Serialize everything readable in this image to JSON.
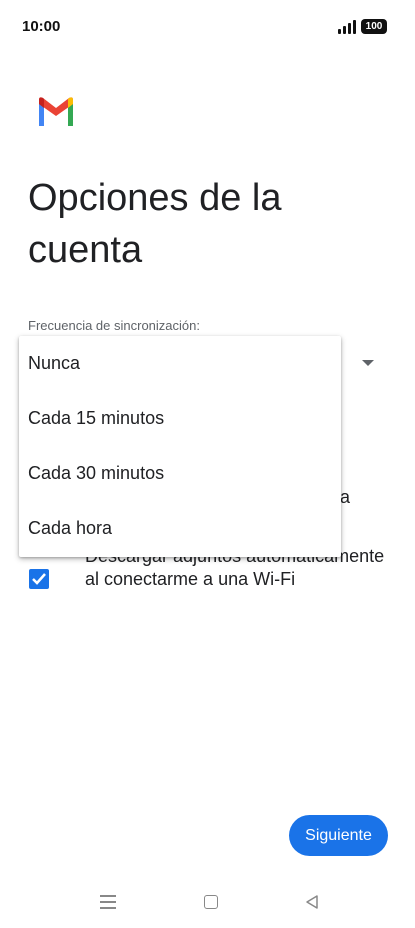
{
  "status_bar": {
    "time": "10:00",
    "battery": "100"
  },
  "title": "Opciones de la cuenta",
  "sync": {
    "label": "Frecuencia de sincronización:",
    "options": [
      "Nunca",
      "Cada 15 minutos",
      "Cada 30 minutos",
      "Cada hora"
    ]
  },
  "hidden_option_fragment": "nta",
  "attachments": {
    "label": "Descargar adjuntos automáticamente al conectarme a una Wi-Fi",
    "checked": true
  },
  "next_button": "Siguiente",
  "colors": {
    "accent": "#1a73e8",
    "text": "#202124",
    "secondary_text": "#5f6368"
  }
}
